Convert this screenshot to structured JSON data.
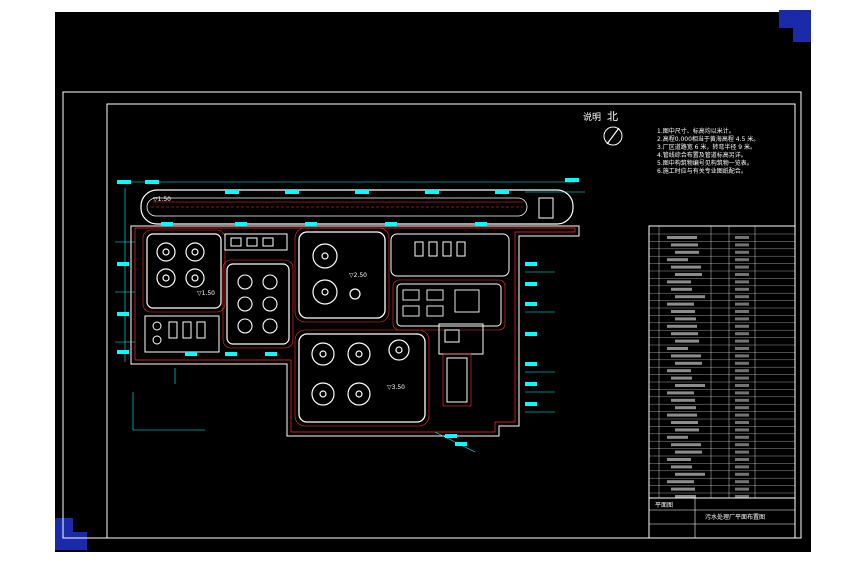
{
  "drawing": {
    "legend_title": "说明",
    "north_label": "北",
    "notes": [
      "1.图中尺寸、标高均以米计。",
      "2.高程0.000相当于黄海高程 4.5 米。",
      "3.厂区道路宽 6 米，转弯半径 9 米。",
      "4.管线综合布置及管道标高另详。",
      "5.图中构筑物编号见构筑物一览表。",
      "6.施工时应与有关专业图纸配合。"
    ],
    "basin_labels": [
      "▽1.50",
      "▽1.50",
      "▽2.50",
      "▽3.50"
    ],
    "title_block": {
      "line1": "平面图",
      "line2": "污水处理厂平面布置图"
    }
  },
  "colors": {
    "sheet": "#000000",
    "border": "#ffffff",
    "pipe": "#ff3030",
    "dimension": "#00ffff",
    "corner": "#1a2aa8"
  }
}
